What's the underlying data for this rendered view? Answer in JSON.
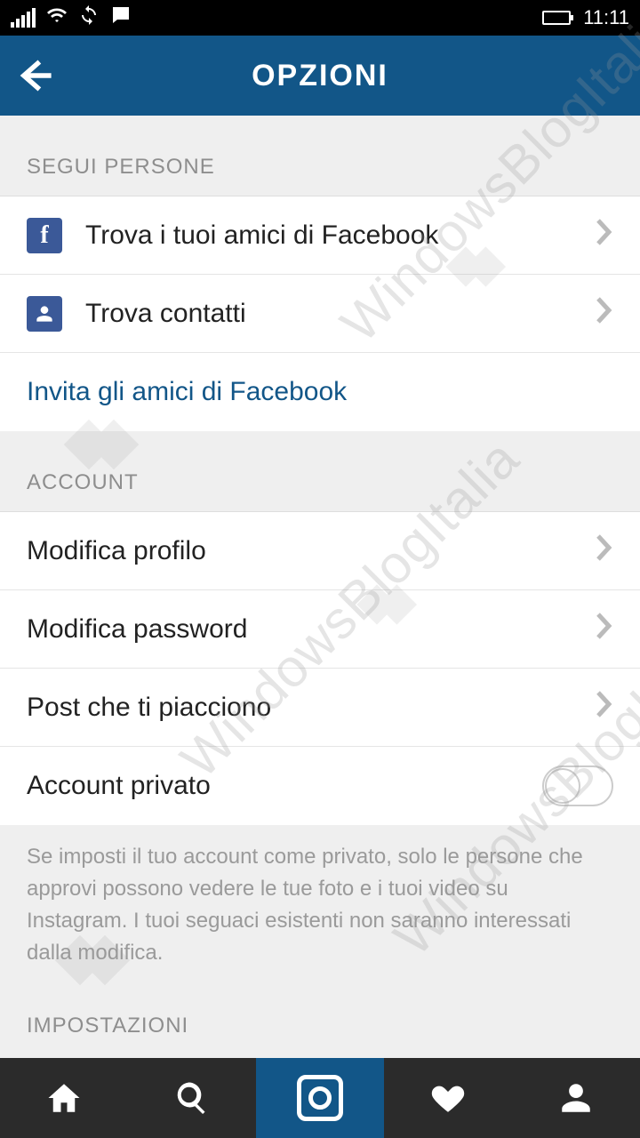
{
  "statusbar": {
    "time": "11:11"
  },
  "header": {
    "title": "OPZIONI"
  },
  "sections": {
    "follow": {
      "header": "SEGUI PERSONE",
      "find_fb": "Trova i tuoi amici di Facebook",
      "find_contacts": "Trova contatti",
      "invite_fb": "Invita gli amici di Facebook"
    },
    "account": {
      "header": "ACCOUNT",
      "edit_profile": "Modifica profilo",
      "change_password": "Modifica password",
      "liked_posts": "Post che ti piacciono",
      "private_account": "Account privato",
      "private_note": "Se imposti il tuo account come privato, solo le persone che approvi possono vedere le tue foto e i tuoi video su Instagram. I tuoi seguaci esistenti non saranno interessati dalla modifica."
    },
    "settings": {
      "header": "IMPOSTAZIONI"
    }
  },
  "watermark": "WindowsBlogItalia"
}
